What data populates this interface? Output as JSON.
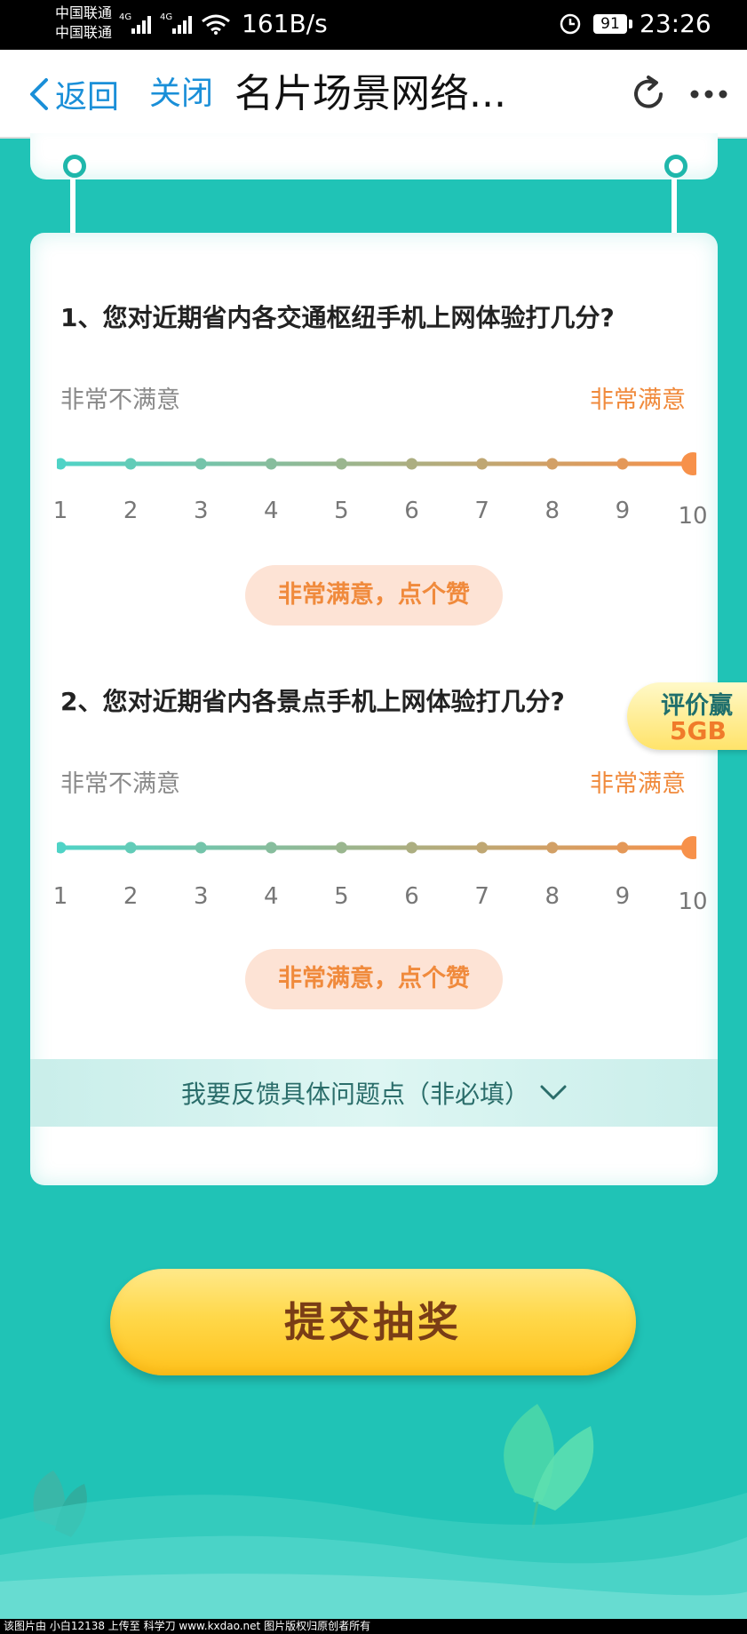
{
  "status_bar": {
    "carrier_1": "中国联通",
    "carrier_2": "中国联通",
    "net_type": "4G",
    "speed": "161B/s",
    "battery": "91",
    "time": "23:26"
  },
  "nav": {
    "back_label": "返回",
    "close_label": "关闭",
    "title": "名片场景网络..."
  },
  "questions": [
    {
      "text": "1、您对近期省内各交通枢纽手机上网体验打几分?",
      "low_label": "非常不满意",
      "high_label": "非常满意",
      "scale": [
        "1",
        "2",
        "3",
        "4",
        "5",
        "6",
        "7",
        "8",
        "9",
        "10"
      ],
      "selected": 10,
      "praise": "非常满意，点个赞"
    },
    {
      "text": "2、您对近期省内各景点手机上网体验打几分?",
      "low_label": "非常不满意",
      "high_label": "非常满意",
      "scale": [
        "1",
        "2",
        "3",
        "4",
        "5",
        "6",
        "7",
        "8",
        "9",
        "10"
      ],
      "selected": 10,
      "praise": "非常满意，点个赞"
    }
  ],
  "feedback_label": "我要反馈具体问题点（非必填）",
  "badge": {
    "line1": "评价赢",
    "line2": "5GB"
  },
  "submit_label": "提交抽奖",
  "watermark": "该图片由 小白12138 上传至 科学刀 www.kxdao.net 图片版权归原创者所有",
  "colors": {
    "background": "#20c3b6",
    "slider_start": "#4fd3c6",
    "slider_end": "#f7914a",
    "link_blue": "#1a8fd8",
    "accent_orange": "#f08a3c",
    "button_yellow": "#ffd84a"
  }
}
